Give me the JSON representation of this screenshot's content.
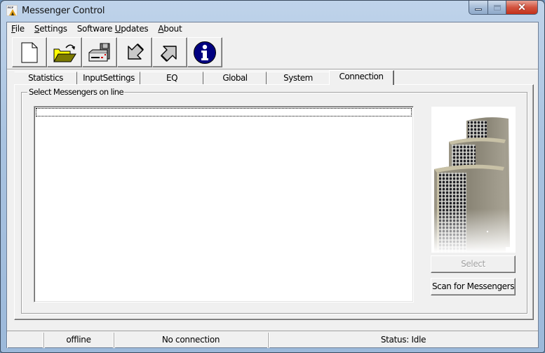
{
  "window": {
    "title": "Messenger Control",
    "app_icon": "rcf-logo-icon",
    "caption_buttons": {
      "minimize": "minimize-icon",
      "maximize": "maximize-icon",
      "close_glyph": "✕"
    }
  },
  "menubar": {
    "items": [
      {
        "label_prefix": "",
        "mnemonic": "F",
        "label_suffix": "ile"
      },
      {
        "label_prefix": "",
        "mnemonic": "S",
        "label_suffix": "ettings"
      },
      {
        "label_prefix": "Software ",
        "mnemonic": "U",
        "label_suffix": "pdates"
      },
      {
        "label_prefix": "",
        "mnemonic": "A",
        "label_suffix": "bout"
      }
    ]
  },
  "toolbar": {
    "buttons": [
      {
        "icon": "new-document-icon",
        "tooltip": "New"
      },
      {
        "icon": "open-folder-icon",
        "tooltip": "Open"
      },
      {
        "icon": "save-disk-drive-icon",
        "tooltip": "Save"
      },
      {
        "icon": "arrow-down-left-icon",
        "tooltip": "Receive"
      },
      {
        "icon": "arrow-up-right-icon",
        "tooltip": "Send"
      },
      {
        "icon": "info-icon",
        "tooltip": "Info"
      }
    ]
  },
  "tabs": [
    {
      "label": "Statistics",
      "active": false
    },
    {
      "label": "InputSettings",
      "active": false
    },
    {
      "label": "EQ",
      "active": false
    },
    {
      "label": "Global",
      "active": false
    },
    {
      "label": "System",
      "active": false
    },
    {
      "label": "Connection",
      "active": true
    }
  ],
  "connection_panel": {
    "group_label": "Select Messengers on line",
    "messengers_list": [],
    "image": "speaker-towers-image",
    "select_button": {
      "label": "Select",
      "enabled": false
    },
    "scan_button": {
      "label": "Scan for Messengers",
      "enabled": true
    }
  },
  "statusbar": {
    "panes": [
      "",
      "offline",
      "No connection",
      "Status: Idle"
    ]
  }
}
